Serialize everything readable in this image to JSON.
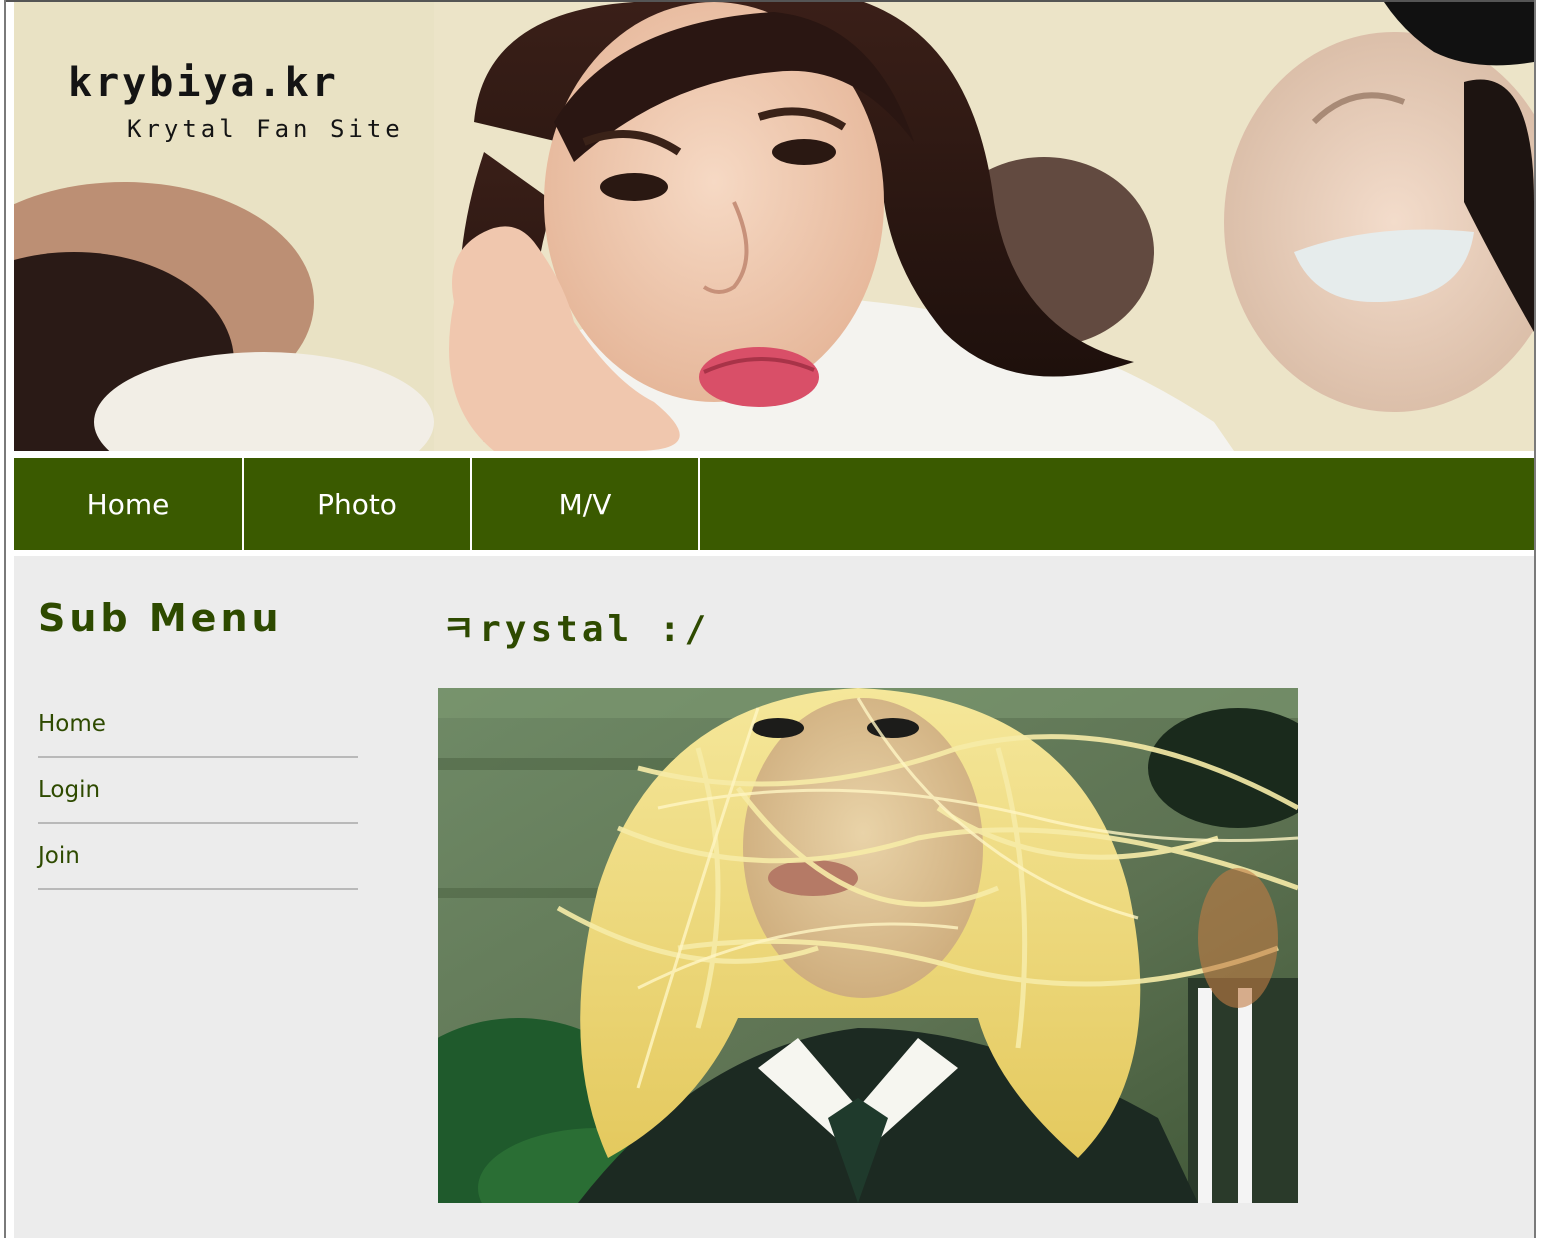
{
  "site": {
    "title": "krybiya.kr",
    "subtitle": "Krytal Fan Site"
  },
  "nav": {
    "items": [
      {
        "label": "Home"
      },
      {
        "label": "Photo"
      },
      {
        "label": "M/V"
      }
    ]
  },
  "sidebar": {
    "title": "Sub Menu",
    "items": [
      {
        "label": "Home"
      },
      {
        "label": "Login"
      },
      {
        "label": "Join"
      }
    ]
  },
  "main": {
    "post_title": "ㅋrystal :/"
  },
  "colors": {
    "nav_bg": "#3a5a00",
    "accent_text": "#2e4a00",
    "content_bg": "#ececec"
  }
}
